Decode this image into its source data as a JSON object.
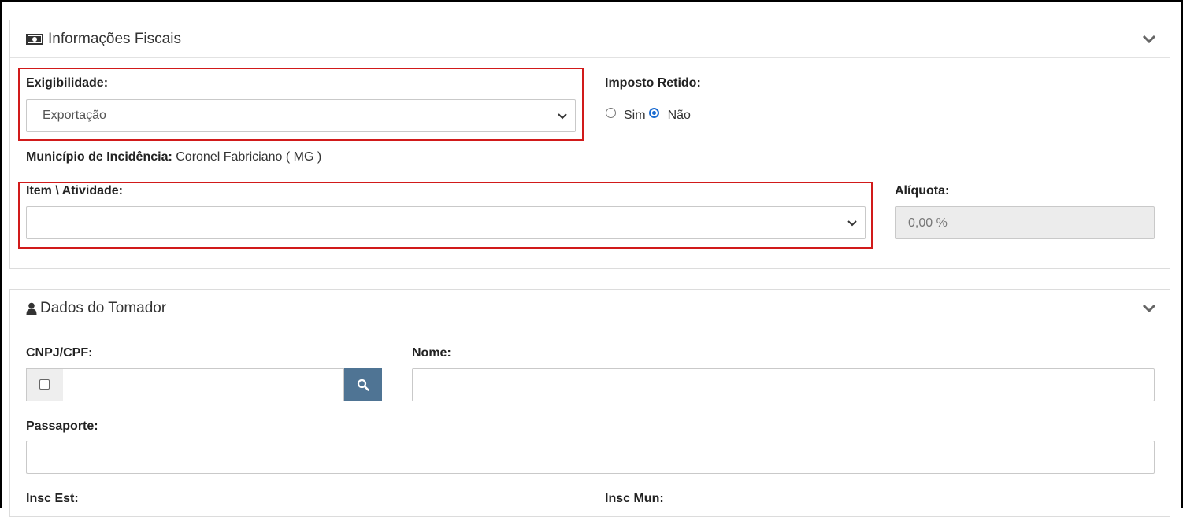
{
  "fiscal": {
    "title": "Informações Fiscais",
    "exigibilidade_label": "Exigibilidade:",
    "exigibilidade_value": "Exportação",
    "imposto_retido_label": "Imposto Retido:",
    "radio_sim": "Sim",
    "radio_nao": "Não",
    "imposto_retido_selected": "Não",
    "municipio_label": "Município de Incidência:",
    "municipio_value": " Coronel Fabriciano ( MG )",
    "item_atividade_label": "Item \\ Atividade:",
    "item_atividade_value": "",
    "aliquota_label": "Alíquota:",
    "aliquota_value": "0,00 %"
  },
  "tomador": {
    "title": "Dados do Tomador",
    "cnpj_label": "CNPJ/CPF:",
    "nome_label": "Nome:",
    "passaporte_label": "Passaporte:",
    "insc_est_label": "Insc Est:",
    "insc_mun_label": "Insc Mun:"
  },
  "colors": {
    "highlight": "#d11a1a",
    "search_button": "#4f7494",
    "radio_checked": "#1a6bd1"
  },
  "icons": {
    "fiscal": "money-icon",
    "tomador": "user-icon",
    "collapse": "chevron-down-icon",
    "search": "search-icon"
  }
}
